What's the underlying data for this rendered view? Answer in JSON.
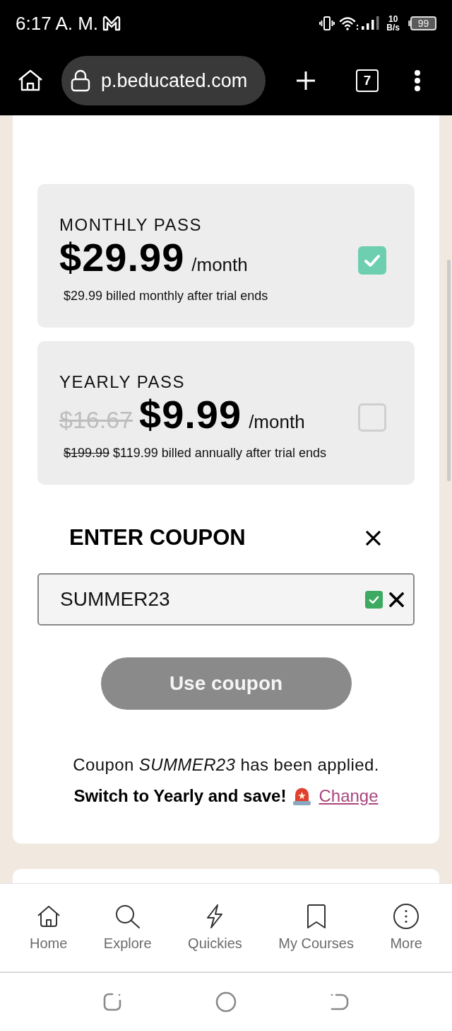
{
  "status_bar": {
    "time": "6:17 A. M.",
    "speed_value": "10",
    "speed_unit": "B/s",
    "battery": "99"
  },
  "browser_bar": {
    "url": "p.beducated.com",
    "tab_count": "7"
  },
  "plans": [
    {
      "name": "MONTHLY PASS",
      "price": "$29.99",
      "period": "/month",
      "billing": "$29.99 billed monthly after trial ends",
      "selected": true
    },
    {
      "name": "YEARLY PASS",
      "original_price": "$16.67",
      "price": "$9.99",
      "period": "/month",
      "billing_original": "$199.99",
      "billing": "$119.99 billed annually after trial ends",
      "selected": false
    }
  ],
  "coupon": {
    "title": "ENTER COUPON",
    "code": "SUMMER23",
    "valid": true,
    "button": {
      "label": "Use coupon",
      "disabled": true
    }
  },
  "message": {
    "applied": "Coupon *SUMMER23* has been applied.",
    "upsell": "Switch to Yearly and save!",
    "link": "Change"
  },
  "bottom_nav": [
    {
      "label": "Home"
    },
    {
      "label": "Explore"
    },
    {
      "label": "Quickies"
    },
    {
      "label": "My Courses"
    },
    {
      "label": "More"
    }
  ]
}
